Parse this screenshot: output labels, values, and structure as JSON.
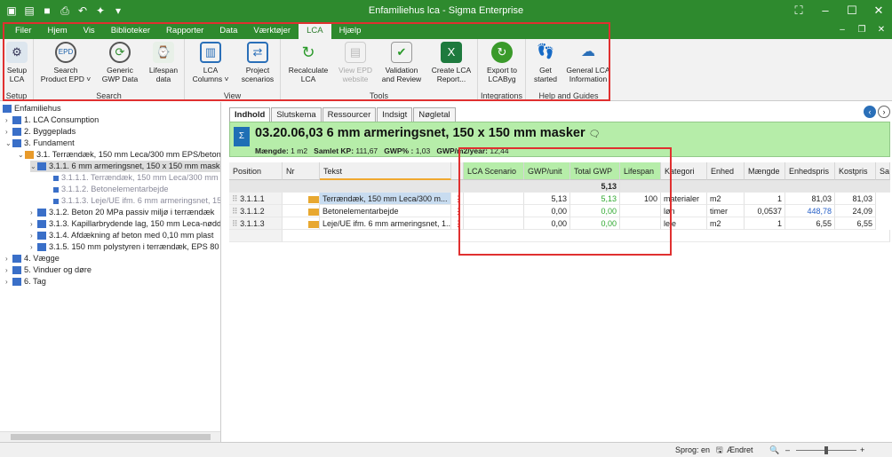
{
  "window": {
    "title": "Enfamiliehus lca - Sigma Enterprise"
  },
  "menu": {
    "tabs": [
      "Filer",
      "Hjem",
      "Vis",
      "Biblioteker",
      "Rapporter",
      "Data",
      "Værktøjer",
      "LCA",
      "Hjælp"
    ],
    "active": "LCA"
  },
  "ribbon": {
    "groups": {
      "setup": "Setup",
      "search": "Search",
      "view": "View",
      "tools": "Tools",
      "integrations": "Integrations",
      "help": "Help and Guides"
    },
    "buttons": {
      "setup_lca": [
        "Setup",
        "LCA"
      ],
      "search_epd": [
        "Search",
        "Product EPD ˅"
      ],
      "generic_gwp": [
        "Generic",
        "GWP Data"
      ],
      "lifespan": [
        "Lifespan",
        "data"
      ],
      "lca_columns": [
        "LCA",
        "Columns ˅"
      ],
      "project_scenarios": [
        "Project",
        "scenarios"
      ],
      "recalculate": [
        "Recalculate",
        "LCA"
      ],
      "view_epd": [
        "View EPD",
        "website"
      ],
      "validation": [
        "Validation",
        "and Review"
      ],
      "create_report": [
        "Create LCA",
        "Report..."
      ],
      "export_lcabyg": [
        "Export to",
        "LCAByg"
      ],
      "get_started": [
        "Get",
        "started"
      ],
      "general_info": [
        "General LCA",
        "Information"
      ]
    }
  },
  "tree": {
    "root": "Enfamiliehus",
    "items": [
      {
        "label": "1. LCA Consumption"
      },
      {
        "label": "2. Byggeplads"
      },
      {
        "label": "3. Fundament"
      },
      {
        "label": "3.1. Terrændæk, 150 mm Leca/300 mm EPS/beton"
      },
      {
        "label": "3.1.1. 6 mm armeringsnet, 150 x 150 mm maske"
      },
      {
        "label": "3.1.1.1. Terrændæk, 150 mm Leca/300 mm E"
      },
      {
        "label": "3.1.1.2. Betonelementarbejde"
      },
      {
        "label": "3.1.1.3. Leje/UE ifm. 6 mm armeringsnet, 150"
      },
      {
        "label": "3.1.2. Beton 20 MPa passiv miljø i terrændæk"
      },
      {
        "label": "3.1.3. Kapillarbrydende lag, 150 mm Leca-nødde"
      },
      {
        "label": "3.1.4. Afdækning af beton med 0,10 mm plast"
      },
      {
        "label": "3.1.5. 150 mm polystyren i terrændæk, EPS 80"
      },
      {
        "label": "4. Vægge"
      },
      {
        "label": "5. Vinduer og døre"
      },
      {
        "label": "6. Tag"
      }
    ]
  },
  "doc_tabs": [
    "Indhold",
    "Slutskema",
    "Ressourcer",
    "Indsigt",
    "Nøgletal"
  ],
  "header": {
    "title": "03.20.06,03 6 mm armeringsnet, 150 x 150 mm masker",
    "m_label": "Mængde:",
    "m_value": "1 m2",
    "kp_label": "Samlet KP:",
    "kp_value": "111,67",
    "gwp_label": "GWP% :",
    "gwp_value": "1,03",
    "gwpm_label": "GWP/m2/year:",
    "gwpm_value": "12,44"
  },
  "grid": {
    "columns": [
      "Position",
      "Nr",
      "Tekst",
      "",
      "LCA Scenario",
      "GWP/unit",
      "Total GWP",
      "Lifespan",
      "Kategori",
      "Enhed",
      "Mængde",
      "Enhedspris",
      "Kostpris",
      "Sa"
    ],
    "summary_total_gwp": "5,13",
    "rows": [
      {
        "pos": "3.1.1.1",
        "text": "Terrændæk, 150 mm Leca/300 m...",
        "gwp_unit": "5,13",
        "total_gwp": "5,13",
        "lifespan": "100",
        "kategori": "materialer",
        "enhed": "m2",
        "maengde": "1",
        "enhedspris": "81,03",
        "kostpris": "81,03"
      },
      {
        "pos": "3.1.1.2",
        "text": "Betonelementarbejde",
        "gwp_unit": "0,00",
        "total_gwp": "0,00",
        "lifespan": "",
        "kategori": "løn",
        "enhed": "timer",
        "maengde": "0,0537",
        "enhedspris": "448,78",
        "kostpris": "24,09"
      },
      {
        "pos": "3.1.1.3",
        "text": "Leje/UE ifm. 6 mm armeringsnet, 1...",
        "gwp_unit": "0,00",
        "total_gwp": "0,00",
        "lifespan": "",
        "kategori": "leje",
        "enhed": "m2",
        "maengde": "1",
        "enhedspris": "6,55",
        "kostpris": "6,55"
      }
    ]
  },
  "statusbar": {
    "lang": "Sprog: en",
    "changed": "Ændret"
  }
}
